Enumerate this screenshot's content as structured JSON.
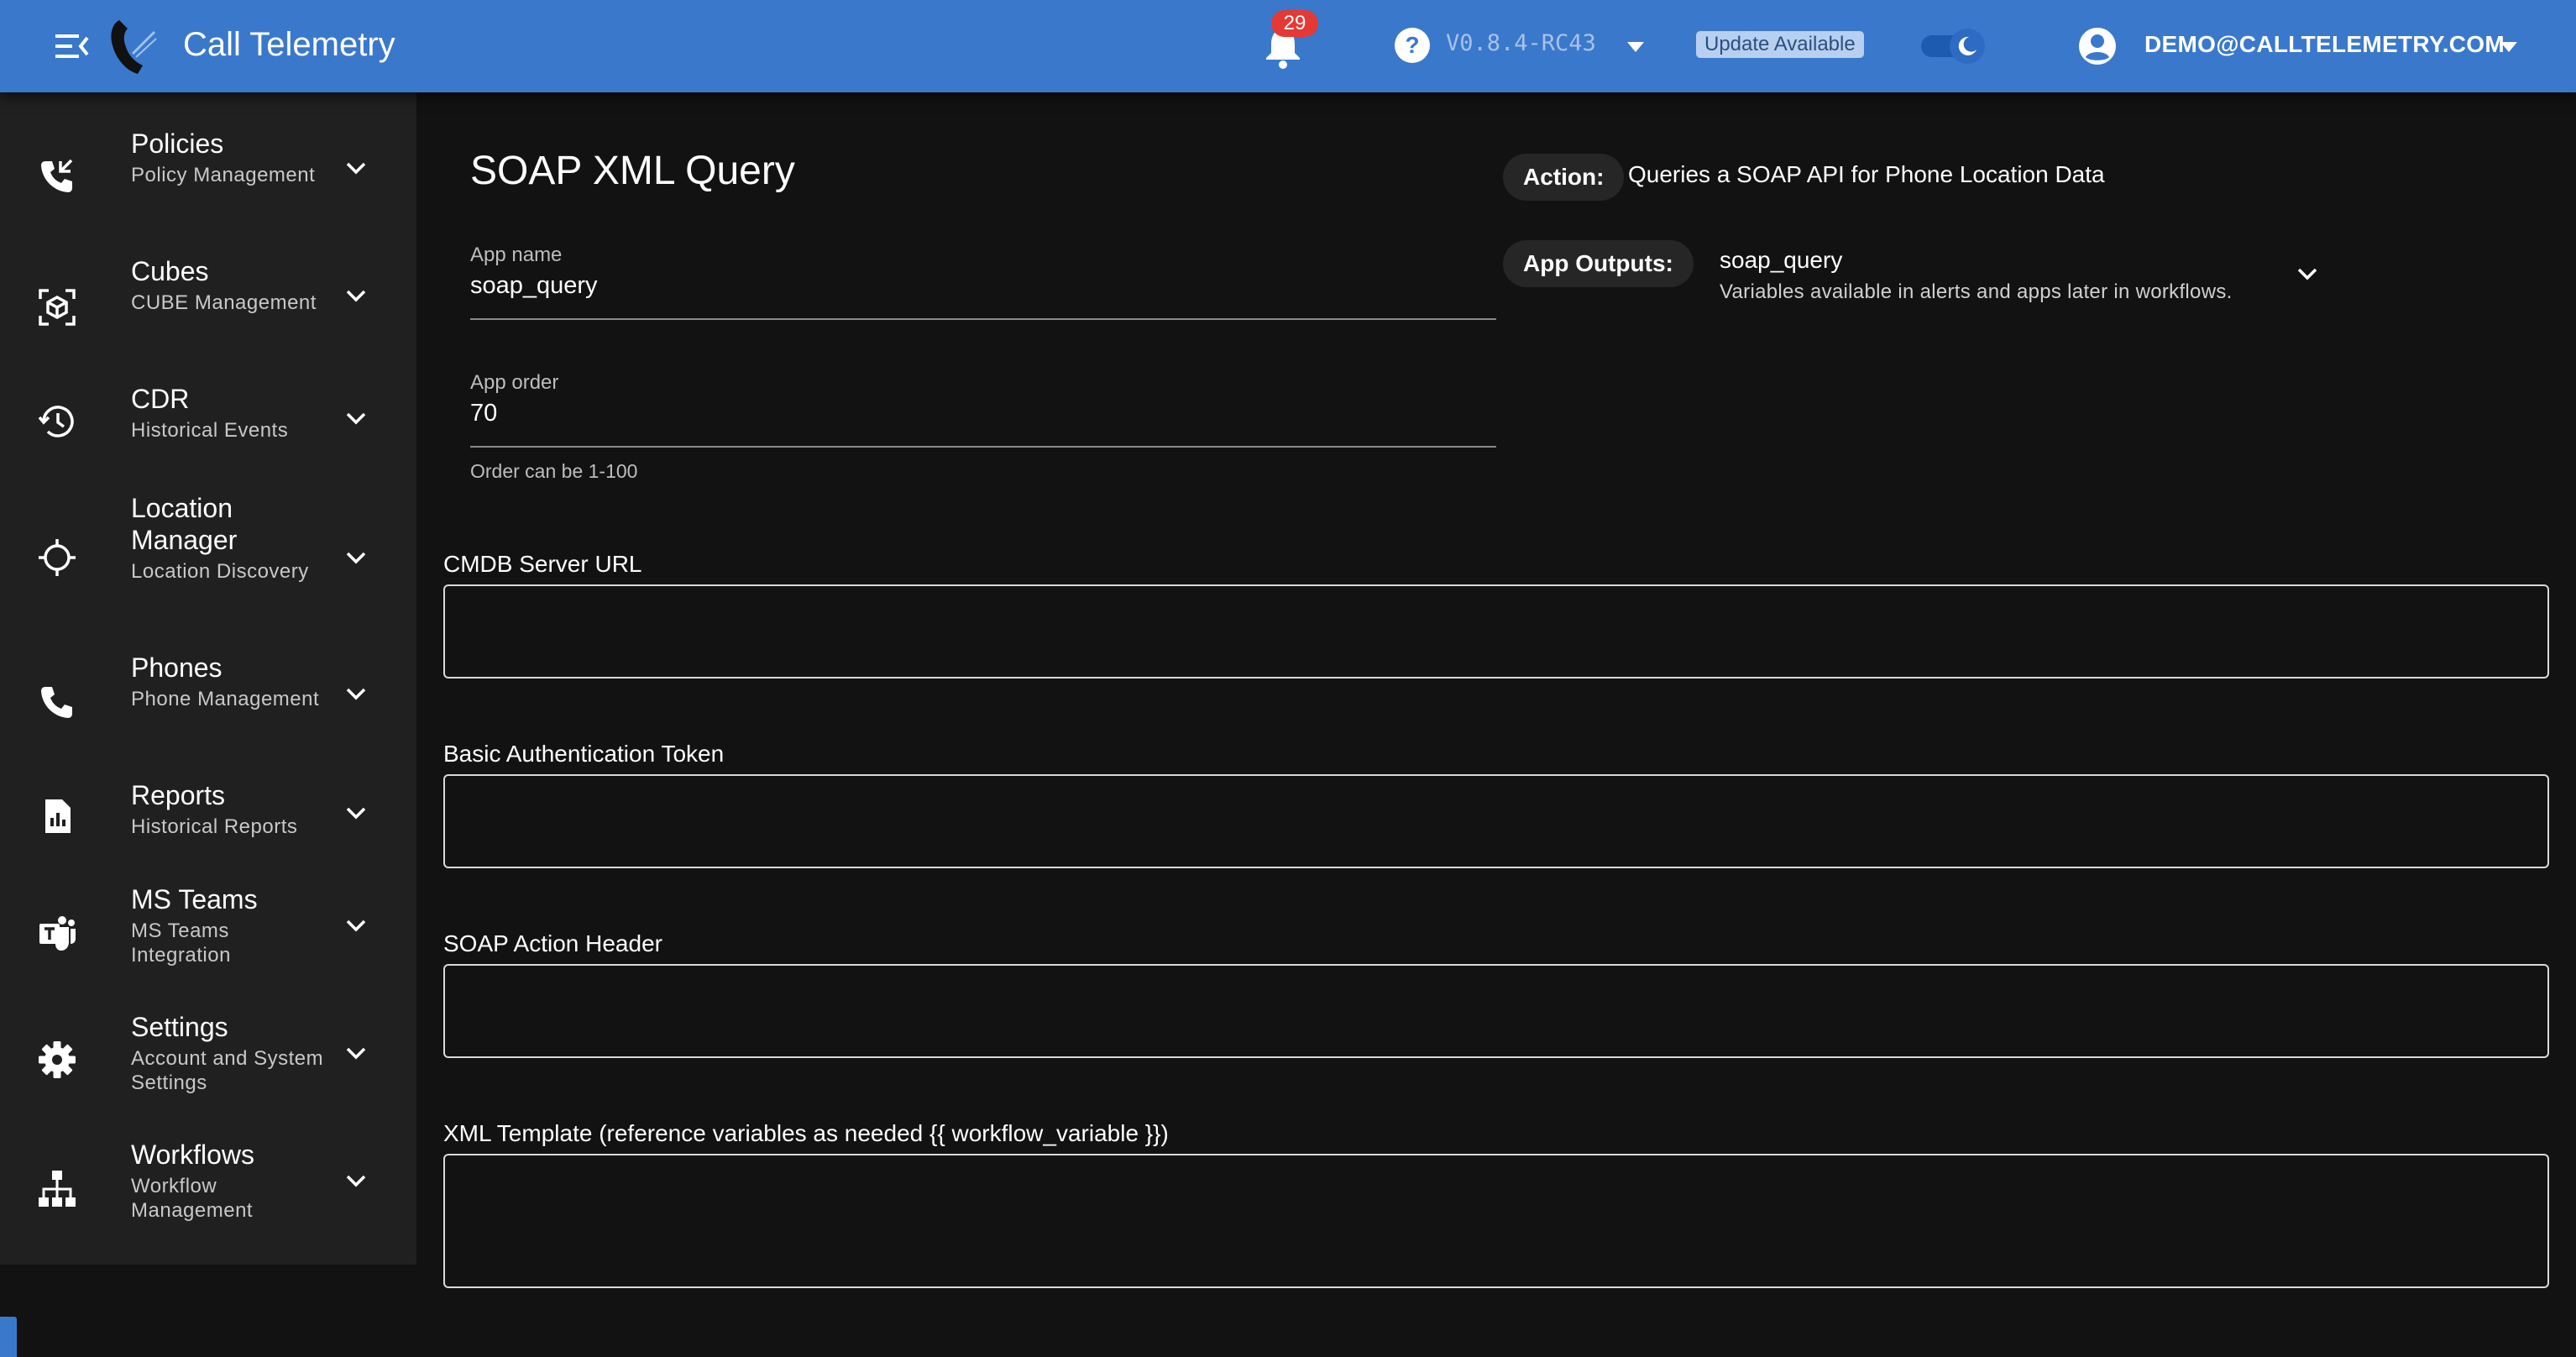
{
  "header": {
    "app_title": "Call Telemetry",
    "notification_count": "29",
    "version": "V0.8.4-RC43",
    "update_label": "Update Available",
    "account_email": "DEMO@CALLTELEMETRY.COM",
    "bar_color": "#3a78cc"
  },
  "sidebar": {
    "items": [
      {
        "title": "Policies",
        "subtitle": "Policy Management",
        "icon": "phone-callback-icon"
      },
      {
        "title": "Cubes",
        "subtitle": "CUBE Management",
        "icon": "cube-scan-icon"
      },
      {
        "title": "CDR",
        "subtitle": "Historical Events",
        "icon": "history-icon"
      },
      {
        "title": "Location Manager",
        "subtitle": "Location Discovery",
        "icon": "crosshair-icon"
      },
      {
        "title": "Phones",
        "subtitle": "Phone Management",
        "icon": "phone-icon"
      },
      {
        "title": "Reports",
        "subtitle": "Historical Reports",
        "icon": "report-icon"
      },
      {
        "title": "MS Teams",
        "subtitle": "MS Teams Integration",
        "icon": "ms-teams-icon"
      },
      {
        "title": "Settings",
        "subtitle": "Account and System Settings",
        "icon": "gear-icon"
      },
      {
        "title": "Workflows",
        "subtitle": "Workflow Management",
        "icon": "sitemap-icon"
      }
    ]
  },
  "main": {
    "page_title": "SOAP XML Query",
    "app_name_label": "App name",
    "app_name_value": "soap_query",
    "app_order_label": "App order",
    "app_order_value": "70",
    "app_order_helper": "Order can be 1-100",
    "action_chip": "Action:",
    "action_text": "Queries a SOAP API for Phone Location Data",
    "outputs_chip": "App Outputs:",
    "outputs_name": "soap_query",
    "outputs_desc": "Variables available in alerts and apps later in workflows.",
    "fields": [
      {
        "label": "CMDB Server URL",
        "value": ""
      },
      {
        "label": "Basic Authentication Token",
        "value": ""
      },
      {
        "label": "SOAP Action Header",
        "value": ""
      },
      {
        "label": "XML Template (reference variables as needed {{ workflow_variable }})",
        "value": ""
      }
    ]
  }
}
